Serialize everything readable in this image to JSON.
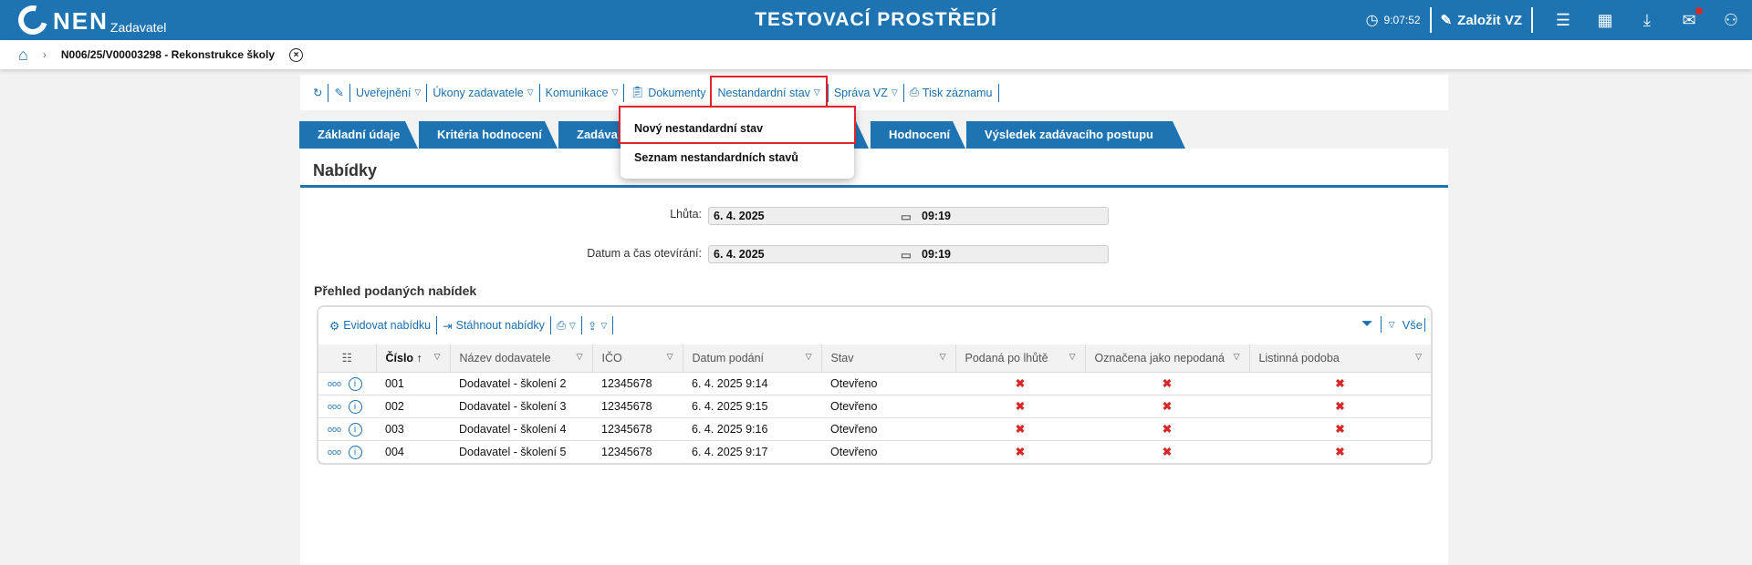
{
  "header": {
    "logo": "NEN",
    "logo_sub": "Zadavatel",
    "env_title": "TESTOVACÍ PROSTŘEDÍ",
    "clock": "9:07:52",
    "create_label": "Založit VZ"
  },
  "breadcrumb": {
    "title": "N006/25/V00003298 - Rekonstrukce školy"
  },
  "toolbar": {
    "publish": "Uveřejnění",
    "acts": "Úkony zadavatele",
    "comm": "Komunikace",
    "docs": "Dokumenty",
    "nonstd": "Nestandardní stav",
    "manage": "Správa VZ",
    "print": "Tisk záznamu"
  },
  "dropdown": {
    "items": [
      "Nový nestandardní stav",
      "Seznam nestandardních stavů"
    ]
  },
  "tabs": [
    "Základní údaje",
    "Kritéria hodnocení",
    "Zadáva",
    "Hodnocení",
    "Výsledek zadávacího postupu"
  ],
  "panel": {
    "title": "Nabídky",
    "fields": [
      {
        "label": "Lhůta:",
        "date": "6. 4. 2025",
        "time": "09:19"
      },
      {
        "label": "Datum a čas otevírání:",
        "date": "6. 4. 2025",
        "time": "09:19"
      }
    ],
    "grid_title": "Přehled podaných nabídek",
    "grid_actions": {
      "register": "Evidovat nabídku",
      "download": "Stáhnout nabídky",
      "filter_all": "Vše"
    },
    "columns": [
      "Číslo",
      "Název dodavatele",
      "IČO",
      "Datum podání",
      "Stav",
      "Podaná po lhůtě",
      "Označena jako nepodaná",
      "Listinná podoba"
    ],
    "rows": [
      {
        "no": "001",
        "name": "Dodavatel - školení 2",
        "ico": "12345678",
        "date": "6. 4. 2025 9:14",
        "state": "Otevřeno"
      },
      {
        "no": "002",
        "name": "Dodavatel - školení 3",
        "ico": "12345678",
        "date": "6. 4. 2025 9:15",
        "state": "Otevřeno"
      },
      {
        "no": "003",
        "name": "Dodavatel - školení 4",
        "ico": "12345678",
        "date": "6. 4. 2025 9:16",
        "state": "Otevřeno"
      },
      {
        "no": "004",
        "name": "Dodavatel - školení 5",
        "ico": "12345678",
        "date": "6. 4. 2025 9:17",
        "state": "Otevřeno"
      }
    ]
  }
}
